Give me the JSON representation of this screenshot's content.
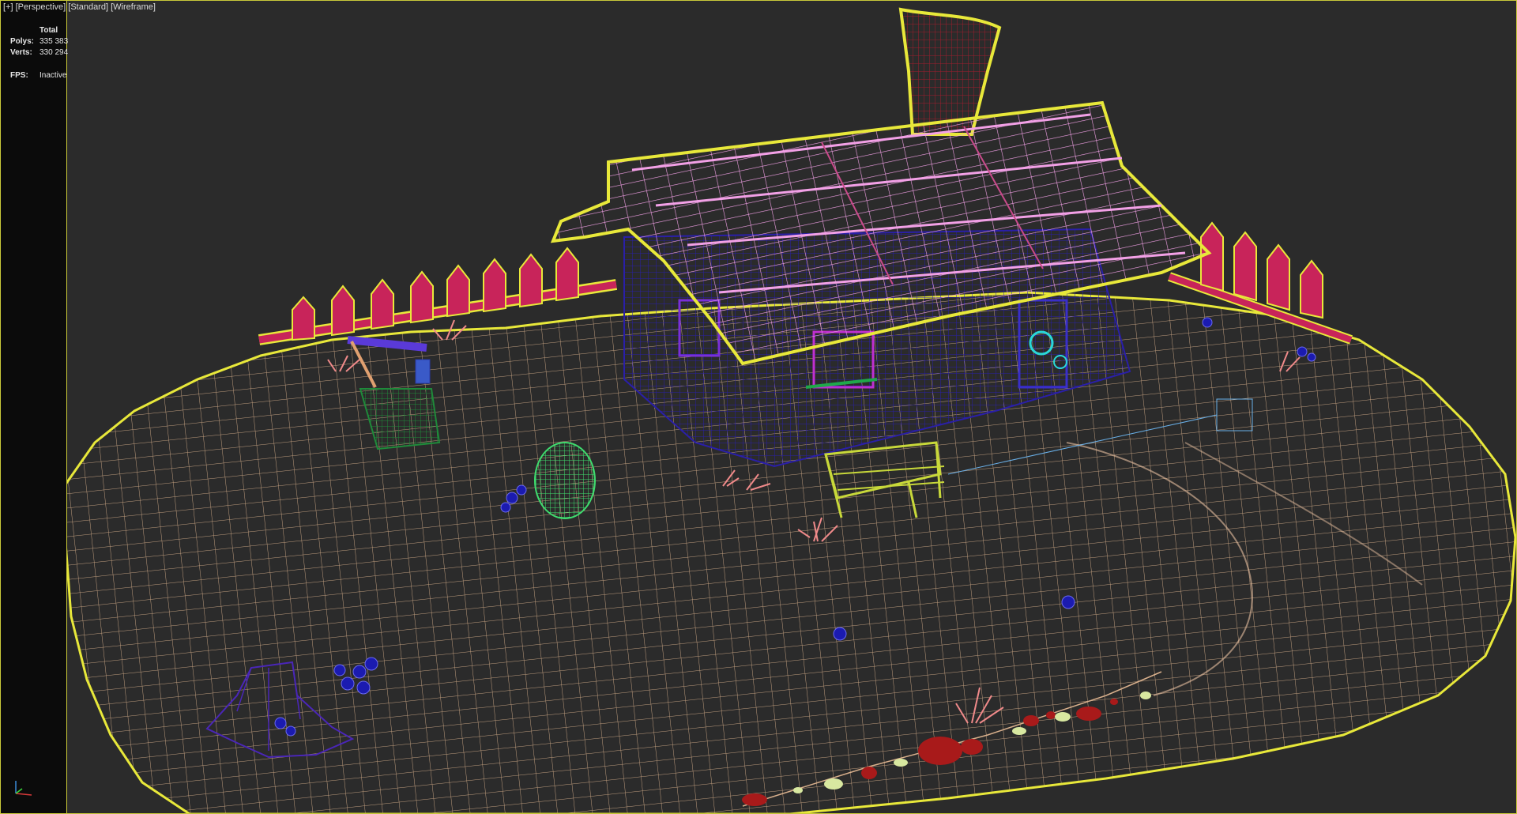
{
  "viewport": {
    "labels": [
      "[+]",
      "[Perspective]",
      "[Standard]",
      "[Wireframe]"
    ],
    "stats": {
      "header": "Total",
      "polys_label": "Polys:",
      "polys_value": "335 383",
      "verts_label": "Verts:",
      "verts_value": "330 294",
      "fps_label": "FPS:",
      "fps_value": "Inactive"
    }
  },
  "colors": {
    "background": "#2b2b2b",
    "ground_wire": "#d9b08c",
    "selection_outline": "#e8e83a",
    "roof": "#e58ad6",
    "house": "#2a1fa8",
    "chimney": "#a01c2e",
    "fence": "#c8245a",
    "barrel": "#3fdc6e",
    "bucket": "#1f8a3a",
    "bench": "#c8d83a",
    "stump": "#4a26b8",
    "flower": "#1b1bb0",
    "stones": "#a81a1a"
  },
  "icons": {
    "axis": "xyz-axis-gizmo-icon"
  }
}
